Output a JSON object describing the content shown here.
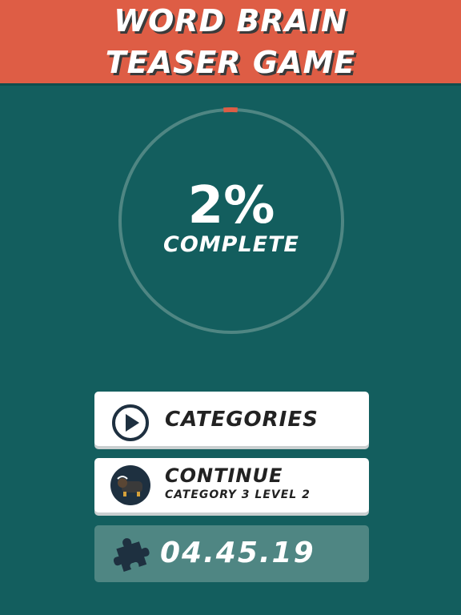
{
  "header": {
    "title_line1": "WORD BRAIN",
    "title_line2": "TEASER GAME"
  },
  "progress": {
    "percent_text": "2%",
    "label": "COMPLETE",
    "fraction": 0.02,
    "accent": "#de5d45"
  },
  "buttons": {
    "categories": {
      "label": "CATEGORIES",
      "icon": "play-circle-icon"
    },
    "continue": {
      "label": "CONTINUE",
      "sublabel": "CATEGORY 3 LEVEL 2",
      "icon": "bison-avatar-icon"
    }
  },
  "timer": {
    "value": "04.45.19",
    "icon": "puzzle-piece-icon"
  },
  "colors": {
    "background": "#135e5e",
    "header": "#de5d45",
    "panel": "#4f8683"
  }
}
